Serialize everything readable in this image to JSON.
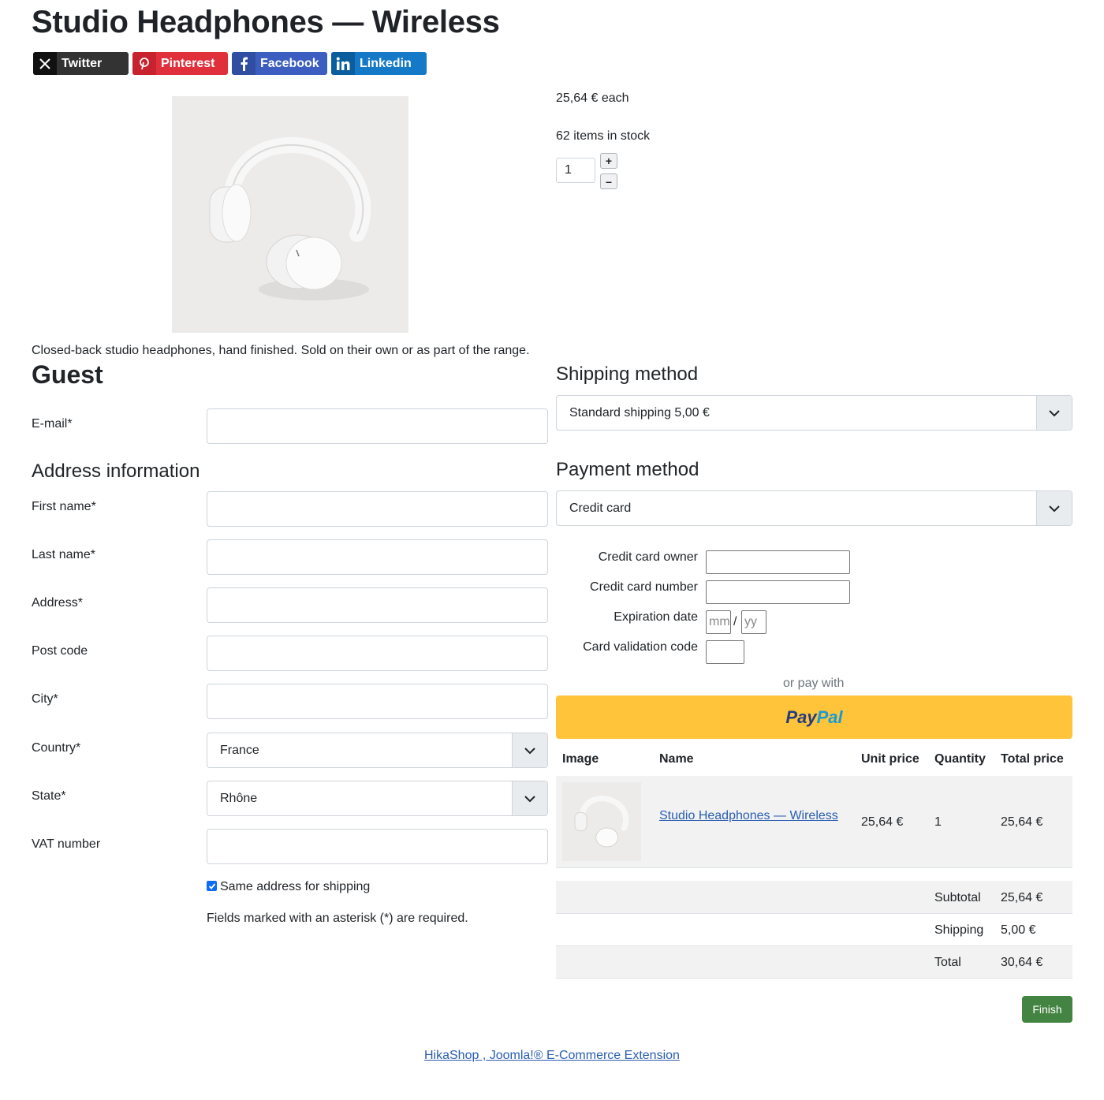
{
  "product": {
    "title": "Studio Headphones — Wireless",
    "price_each": "25,64 € each",
    "stock": "62 items in stock",
    "quantity": "1",
    "qty_plus": "+",
    "qty_minus": "–",
    "description": "Closed-back studio headphones, hand finished. Sold on their own or as part of the range."
  },
  "share": [
    {
      "label": "Twitter",
      "icon": "x-logo-icon"
    },
    {
      "label": "Pinterest",
      "icon": "pinterest-icon"
    },
    {
      "label": "Facebook",
      "icon": "facebook-icon"
    },
    {
      "label": "Linkedin",
      "icon": "linkedin-icon"
    }
  ],
  "guest": {
    "heading": "Guest",
    "email_label": "E-mail*"
  },
  "address": {
    "heading": "Address information",
    "first_name": "First name*",
    "last_name": "Last name*",
    "address": "Address*",
    "post_code": "Post code",
    "city": "City*",
    "country": "Country*",
    "country_value": "France",
    "state": "State*",
    "state_value": "Rhône",
    "vat": "VAT number",
    "same_address": "Same address for shipping",
    "required_note": "Fields marked with an asterisk (*) are required."
  },
  "shipping": {
    "heading": "Shipping method",
    "selected": "Standard shipping 5,00 €"
  },
  "payment": {
    "heading": "Payment method",
    "selected": "Credit card",
    "cc_owner": "Credit card owner",
    "cc_number": "Credit card number",
    "expiration": "Expiration date",
    "exp_mm_placeholder": "mm",
    "exp_sep": "/",
    "exp_yy_placeholder": "yy",
    "cvc": "Card validation code",
    "or_pay_with": "or pay with",
    "paypal_1": "Pay",
    "paypal_2": "Pal"
  },
  "cart": {
    "headers": [
      "Image",
      "Name",
      "Unit price",
      "Quantity",
      "Total price"
    ],
    "item": {
      "name": "Studio Headphones — Wireless",
      "unit_price": "25,64 €",
      "quantity": "1",
      "total": "25,64 €"
    },
    "subtotal_label": "Subtotal",
    "subtotal": "25,64 €",
    "shipping_label": "Shipping",
    "shipping": "5,00 €",
    "total_label": "Total",
    "total": "30,64 €"
  },
  "finish_label": "Finish",
  "footer_link": "HikaShop , Joomla!® E-Commerce Extension",
  "colors": {
    "accent_finish": "#448442",
    "paypal_yellow": "#ffc43a",
    "link": "#2a5db0",
    "checkbox": "#0b6cf5"
  }
}
